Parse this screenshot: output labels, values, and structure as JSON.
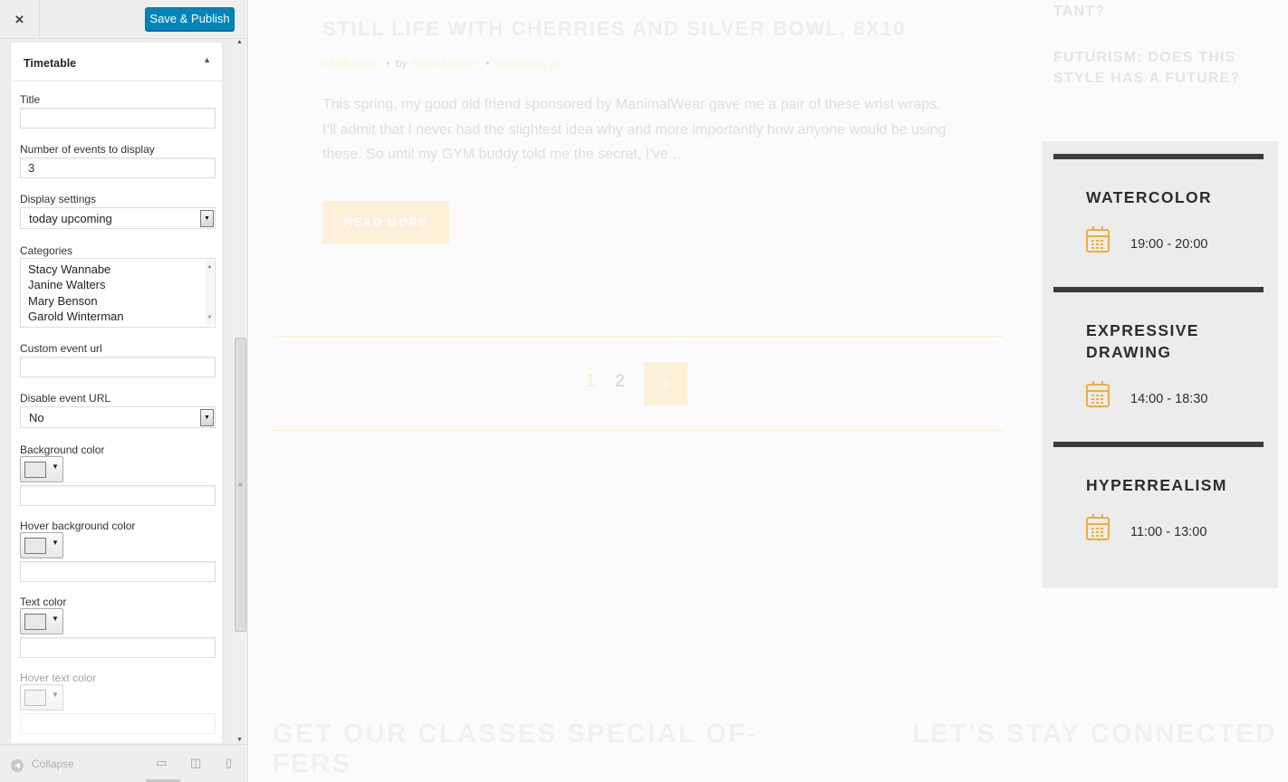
{
  "sidebar": {
    "close_label": "×",
    "publish_label": "Save & Publish",
    "widget": {
      "title": "Timetable",
      "toggle_icon": "▲",
      "fields": {
        "title_label": "Title",
        "title_value": "",
        "events_label": "Number of events to display",
        "events_value": "3",
        "display_label": "Display settings",
        "display_value": "today upcoming",
        "categories_label": "Categories",
        "categories": [
          "Stacy Wannabe",
          "Janine Walters",
          "Mary Benson",
          "Garold Winterman"
        ],
        "custom_url_label": "Custom event url",
        "custom_url_value": "",
        "disable_url_label": "Disable event URL",
        "disable_url_value": "No",
        "bg_color_label": "Background color",
        "hover_bg_color_label": "Hover background color",
        "text_color_label": "Text color",
        "hover_text_color_label": "Hover text color"
      }
    },
    "footer": {
      "collapse_label": "Collapse",
      "devices": [
        "desktop-icon",
        "tablet-icon",
        "mobile-icon"
      ]
    }
  },
  "preview": {
    "post": {
      "title": "STILL LIFE WITH CHERRIES AND SILVER BOWL, 8X10",
      "date": "04.05.2016",
      "by": "by",
      "author": "Steve Ayokee",
      "comments": "comments (0)",
      "excerpt": "This spring, my good old friend sponsored by ManimalWear gave me a pair of these wrist wraps. I’ll admit that I never had the slightest idea why and more importantly how anyone would be using these. So until my GYM buddy told me the secret, I’ve…",
      "read_more": "READ MORE"
    },
    "pagination": {
      "pages": [
        "1",
        "2"
      ],
      "next_icon": "›"
    },
    "recent": [
      "TANT?",
      "FUTURISM: DOES THIS STYLE HAS A FUTURE?"
    ],
    "events": [
      {
        "name": "WATERCOLOR",
        "time": "19:00 - 20:00"
      },
      {
        "name": "EXPRESSIVE DRAWING",
        "time": "14:00 - 18:30"
      },
      {
        "name": "HYPERREALISM",
        "time": "11:00 - 13:00"
      }
    ],
    "footer": {
      "left_heading": "GET OUR CLASSES SPECIAL OF- FERS",
      "right_heading": "LET'S STAY CONNECTED"
    },
    "accent_color": "#efae3a"
  }
}
